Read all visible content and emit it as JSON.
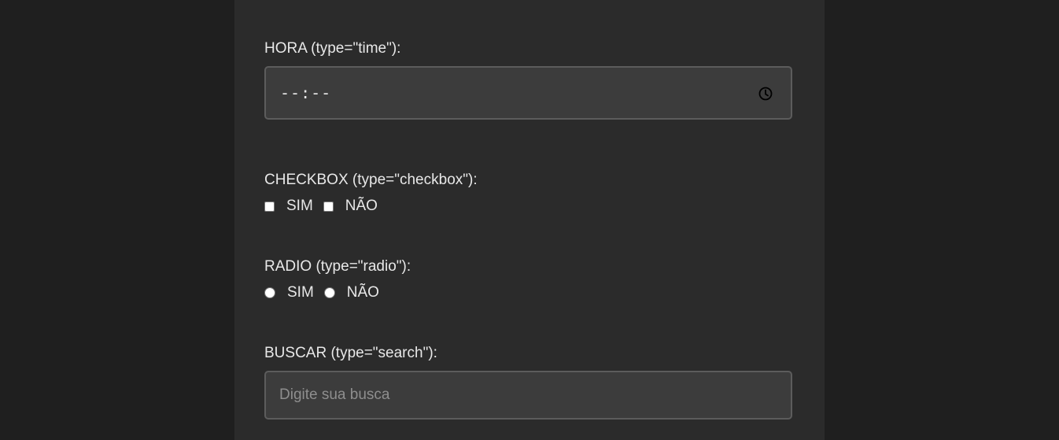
{
  "time_field": {
    "label": "HORA (type=\"time\"):",
    "value": "--:--",
    "icon": "clock-icon"
  },
  "checkbox_field": {
    "label": "CHECKBOX (type=\"checkbox\"):",
    "options": [
      {
        "label": "SIM",
        "checked": false
      },
      {
        "label": "NÃO",
        "checked": false
      }
    ]
  },
  "radio_field": {
    "label": "RADIO (type=\"radio\"):",
    "options": [
      {
        "label": "SIM",
        "selected": false
      },
      {
        "label": "NÃO",
        "selected": false
      }
    ]
  },
  "search_field": {
    "label": "BUSCAR (type=\"search\"):",
    "placeholder": "Digite sua busca"
  },
  "colors": {
    "page_background": "#1f1f1f",
    "panel_background": "#2b2b2b",
    "input_background": "#3c3c3c",
    "input_border": "#5c5c5c"
  }
}
